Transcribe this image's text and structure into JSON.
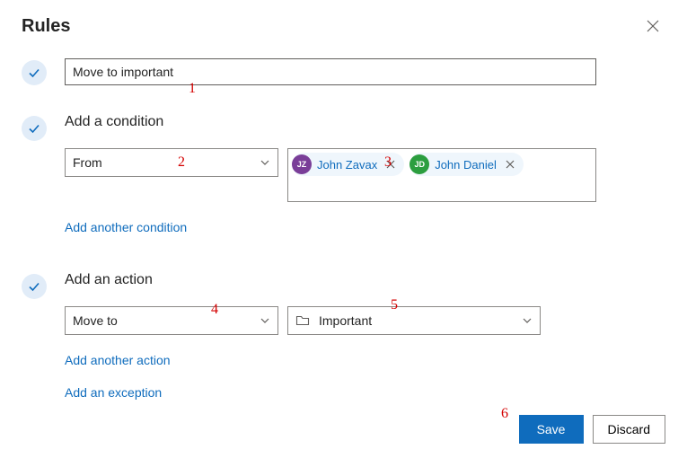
{
  "title": "Rules",
  "rule_name": "Move to important",
  "condition": {
    "heading": "Add a condition",
    "type": "From",
    "people": [
      {
        "initials": "JZ",
        "name": "John Zavax",
        "avatar_class": "avatar-purple"
      },
      {
        "initials": "JD",
        "name": "John Daniel",
        "avatar_class": "avatar-green"
      }
    ],
    "add_link": "Add another condition"
  },
  "action": {
    "heading": "Add an action",
    "type": "Move to",
    "folder": "Important",
    "add_action_link": "Add another action",
    "add_exception_link": "Add an exception"
  },
  "footer": {
    "save": "Save",
    "discard": "Discard"
  },
  "annotations": {
    "n1": "1",
    "n2": "2",
    "n3": "3",
    "n4": "4",
    "n5": "5",
    "n6": "6"
  }
}
